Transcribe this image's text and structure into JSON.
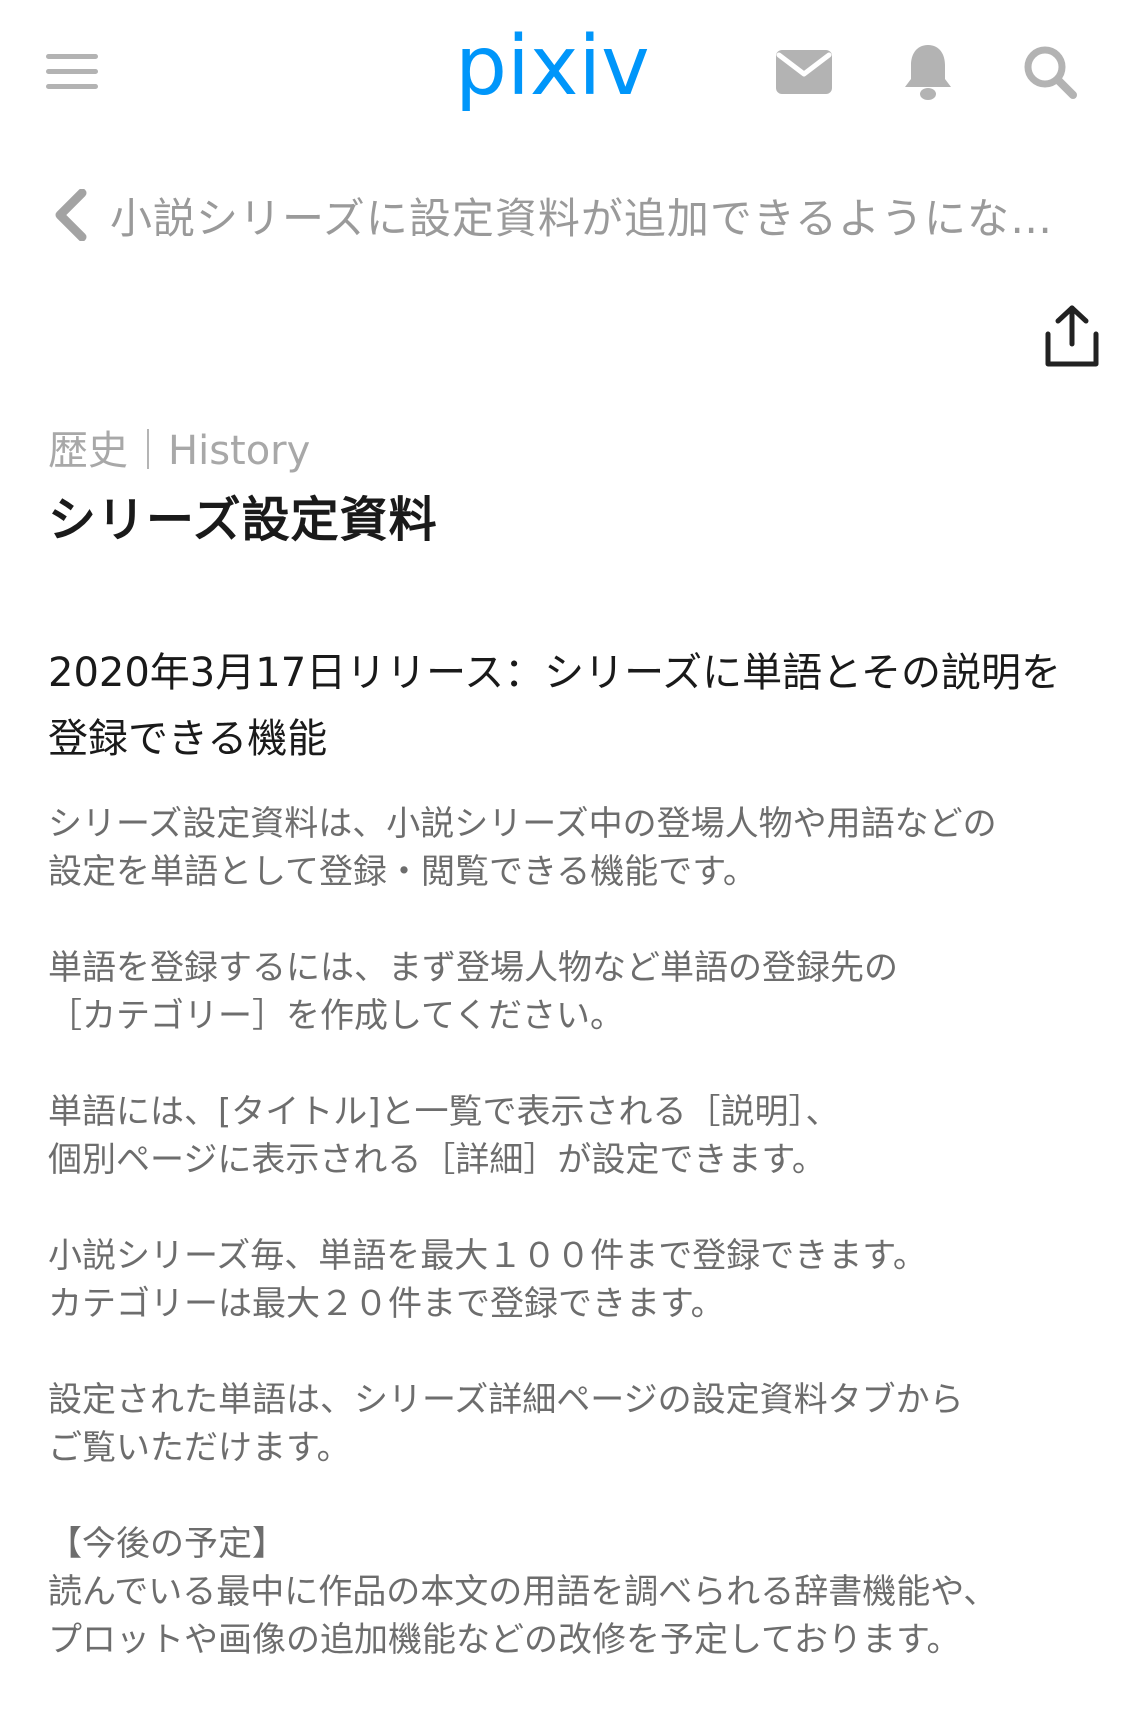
{
  "app": {
    "logo_text": "pixiv",
    "brand_color": "#0096fa"
  },
  "header": {
    "icons": [
      "menu-icon",
      "mail-icon",
      "bell-icon",
      "search-icon"
    ]
  },
  "nav": {
    "back_title": "小説シリーズに設定資料が追加できるようになりました",
    "share_icon": "share-icon"
  },
  "article": {
    "category": "歴史｜History",
    "title": "シリーズ設定資料",
    "heading": "2020年3月17日リリース：シリーズに単語とその説明を登録できる機能",
    "paragraphs": [
      {
        "lines": [
          " シリーズ設定資料は、小説シリーズ中の登場人物や用語などの",
          "設定を単語として登録・閲覧できる機能です。"
        ]
      },
      {
        "lines": [
          "単語を登録するには、まず登場人物など単語の登録先の",
          "［カテゴリー］を作成してください。"
        ]
      },
      {
        "lines": [
          "単語には、[タイトル]と一覧で表示される［説明］、",
          "個別ページに表示される［詳細］が設定できます。"
        ]
      },
      {
        "lines": [
          "小説シリーズ毎、単語を最大１００件まで登録できます。",
          "カテゴリーは最大２０件まで登録できます。"
        ]
      },
      {
        "lines": [
          "設定された単語は、シリーズ詳細ページの設定資料タブから",
          "ご覧いただけます。"
        ]
      },
      {
        "lines": [
          "【今後の予定】",
          "読んでいる最中に作品の本文の用語を調べられる辞書機能や、",
          "プロットや画像の追加機能などの改修を予定しております。"
        ]
      }
    ]
  },
  "colors": {
    "icon_gray": "#b3b3b3",
    "muted_text": "#6d6d6d",
    "title_text": "#1a1a1a"
  }
}
